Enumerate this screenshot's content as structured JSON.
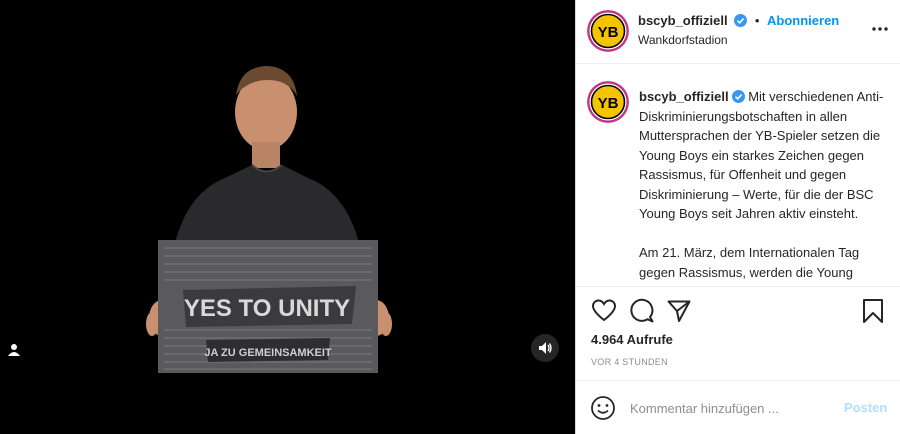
{
  "post": {
    "username": "bscyb_offiziell",
    "follow_label": "Abonnieren",
    "separator": "•",
    "location": "Wankdorfstadion",
    "caption_p1": "Mit verschiedenen Anti-Diskriminierungsbotschaften in allen Muttersprachen der YB-Spieler setzen die Young Boys ein starkes Zeichen gegen Rassismus, für Offenheit und gegen Diskriminierung – Werte, für die der BSC Young Boys seit Jahren aktiv einsteht.",
    "caption_p2": "Am 21. März, dem Internationalen Tag gegen Rassismus, werden die Young",
    "views": "4.964 Aufrufe",
    "time": "VOR 4 STUNDEN",
    "comment_placeholder": "Kommentar hinzufügen ...",
    "post_label": "Posten"
  },
  "media": {
    "sign_main": "YES TO UNITY",
    "sign_sub": "JA ZU GEMEINSAMKEIT"
  },
  "icons": {
    "heart": "heart-icon",
    "comment": "comment-icon",
    "share": "share-icon",
    "save": "bookmark-icon",
    "emoji": "emoji-icon",
    "more": "more-options-icon",
    "sound": "sound-icon",
    "user_tag": "user-tag-icon"
  },
  "colors": {
    "accent": "#0095f6",
    "club_yellow": "#f5c400"
  }
}
